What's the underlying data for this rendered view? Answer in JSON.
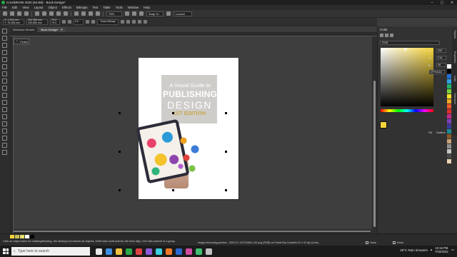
{
  "window": {
    "title": "CorelDRAW 2020 (64-Bit) - Book Design*",
    "controls": [
      "–",
      "▢",
      "✕"
    ]
  },
  "menu": [
    "File",
    "Edit",
    "View",
    "Layout",
    "Object",
    "Effects",
    "Bitmaps",
    "Text",
    "Table",
    "Tools",
    "Window",
    "Help"
  ],
  "toolbar": {
    "zoom": "75%",
    "snap_label": "Snap To",
    "launch_label": "Launch"
  },
  "property_bar": {
    "x": "X: 1.204 mm",
    "y": "Y: 76.308 mm",
    "w": "152.355 mm",
    "h": "109.889 mm",
    "scale_x": "79.3",
    "scale_y": "79.3",
    "rotation": "0.0",
    "bitmap_label": "Trace Bitmap"
  },
  "tabs": [
    {
      "label": "Welcome Screen"
    },
    {
      "label": "Book Design*"
    }
  ],
  "finish_button": "Finish",
  "book_cover": {
    "line1": "A Visual Guide to",
    "line2": "PUBLISHING",
    "line3": "DESIGN",
    "line4": "1ST EDITION"
  },
  "color_docker": {
    "title": "Color",
    "model": "RGB",
    "rgb_labels": [
      "R:",
      "G:",
      "B:"
    ],
    "rgb_values": [
      "255",
      "218",
      "58"
    ],
    "hex": "#FFDA3A",
    "fill_label": "Fill",
    "outline_label": "Outline",
    "current_color": "#f6d43a"
  },
  "dock_tabs": [
    "Objects",
    "Properties",
    "Color",
    "Transform"
  ],
  "palette_colors": [
    "#ffffff",
    "#000000",
    "#1f6fd1",
    "#2fa4e7",
    "#21b36b",
    "#7bd13a",
    "#f5e028",
    "#f7a823",
    "#f05a28",
    "#e12b2b",
    "#c42a8a",
    "#7a3fb8",
    "#3a3a9a",
    "#1c8a9a",
    "#8a5a2a",
    "#c9a27a",
    "#8f8f8f",
    "#c4c4c4",
    "#4a4a4a",
    "#e8d3b5"
  ],
  "doc_palette_colors": [
    "#f6d43a",
    "#c9c15a",
    "#e8e06a",
    "#ffffff",
    "#000000"
  ],
  "status": {
    "hint": "Click an object twice for rotating/skewing; dbl-clicking tool selects all objects; Shift+click multi-selects; Alt+click digs; Ctrl+click selects in a group",
    "info": "image-removebg-preview - 2022-07-13T210644.142.png (RGB) on PowerClip Contents 91 x 91 dpi (Lens)",
    "fill_label": "None",
    "outline_label": "None"
  },
  "taskbar": {
    "search_placeholder": "Type here to search",
    "weather": "26°C  Rain showers",
    "time": "10:16 PM",
    "date": "7/16/2022",
    "icon_colors": [
      "#e8e8e8",
      "#3f8fe0",
      "#f0c040",
      "#2aa84a",
      "#e04040",
      "#8a5ad8",
      "#3ad0e0",
      "#f07a2a",
      "#2a6ad0",
      "#d04aa0",
      "#40c070",
      "#c0c0c0"
    ]
  }
}
